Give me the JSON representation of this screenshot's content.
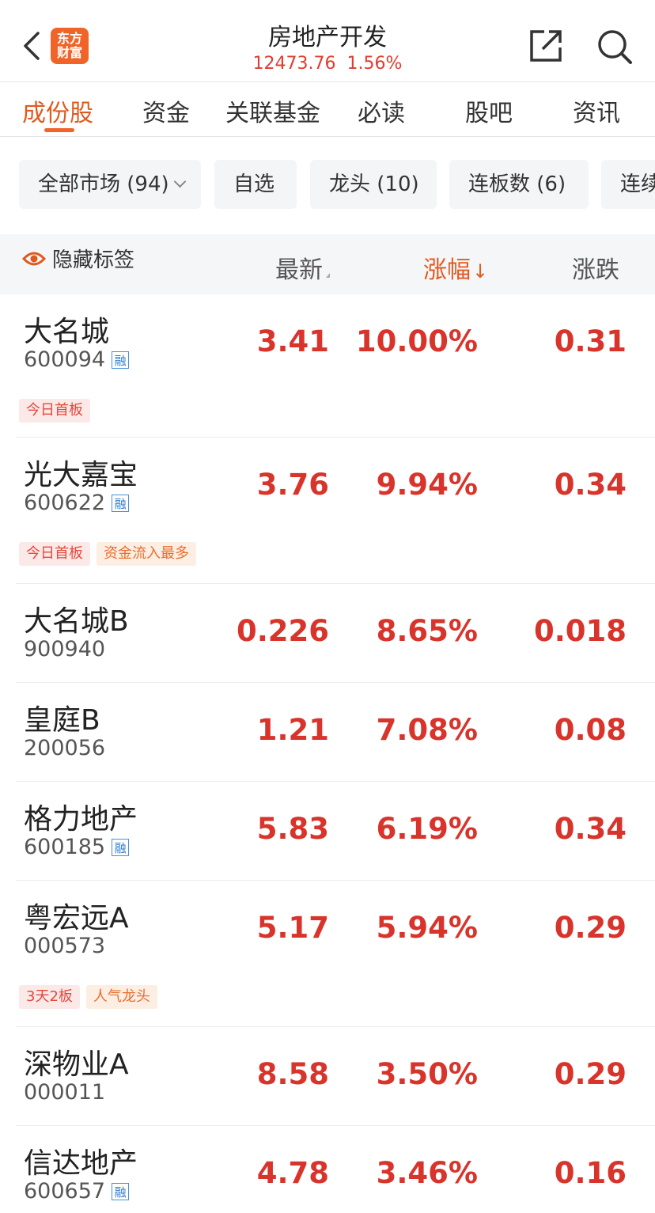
{
  "header": {
    "logo_line1": "东方",
    "logo_line2": "财富",
    "title": "房地产开发",
    "index_value": "12473.76",
    "index_change": "1.56%"
  },
  "tabs": [
    {
      "label": "成份股",
      "active": true
    },
    {
      "label": "资金"
    },
    {
      "label": "关联基金"
    },
    {
      "label": "必读"
    },
    {
      "label": "股吧"
    },
    {
      "label": "资讯"
    }
  ],
  "filters": [
    {
      "label": "全部市场 (94)",
      "has_dropdown": true
    },
    {
      "label": "自选"
    },
    {
      "label": "龙头 (10)"
    },
    {
      "label": "连板数 (6)"
    },
    {
      "label": "连续"
    }
  ],
  "columns": {
    "hide_tags": "隐藏标签",
    "latest": "最新",
    "change_pct": "涨幅",
    "change": "涨跌",
    "sort_arrow": "↓"
  },
  "stocks": [
    {
      "name": "大名城",
      "code": "600094",
      "margin": true,
      "price": "3.41",
      "pct": "10.00%",
      "chg": "0.31",
      "tags": [
        {
          "text": "今日首板",
          "style": "red"
        }
      ]
    },
    {
      "name": "光大嘉宝",
      "code": "600622",
      "margin": true,
      "price": "3.76",
      "pct": "9.94%",
      "chg": "0.34",
      "tags": [
        {
          "text": "今日首板",
          "style": "red"
        },
        {
          "text": "资金流入最多",
          "style": "orange"
        }
      ]
    },
    {
      "name": "大名城B",
      "code": "900940",
      "margin": false,
      "price": "0.226",
      "pct": "8.65%",
      "chg": "0.018",
      "tags": []
    },
    {
      "name": "皇庭B",
      "code": "200056",
      "margin": false,
      "price": "1.21",
      "pct": "7.08%",
      "chg": "0.08",
      "tags": []
    },
    {
      "name": "格力地产",
      "code": "600185",
      "margin": true,
      "price": "5.83",
      "pct": "6.19%",
      "chg": "0.34",
      "tags": []
    },
    {
      "name": "粤宏远A",
      "code": "000573",
      "margin": false,
      "price": "5.17",
      "pct": "5.94%",
      "chg": "0.29",
      "tags": [
        {
          "text": "3天2板",
          "style": "red"
        },
        {
          "text": "人气龙头",
          "style": "orange"
        }
      ]
    },
    {
      "name": "深物业A",
      "code": "000011",
      "margin": false,
      "price": "8.58",
      "pct": "3.50%",
      "chg": "0.29",
      "tags": []
    },
    {
      "name": "信达地产",
      "code": "600657",
      "margin": true,
      "price": "4.78",
      "pct": "3.46%",
      "chg": "0.16",
      "tags": []
    }
  ],
  "margin_badge": "融",
  "icons": {
    "back": "chevron-left-icon",
    "share": "share-external-icon",
    "search": "search-icon",
    "eye": "eye-icon"
  },
  "colors": {
    "accent": "#f0642a",
    "up": "#d8342b"
  }
}
